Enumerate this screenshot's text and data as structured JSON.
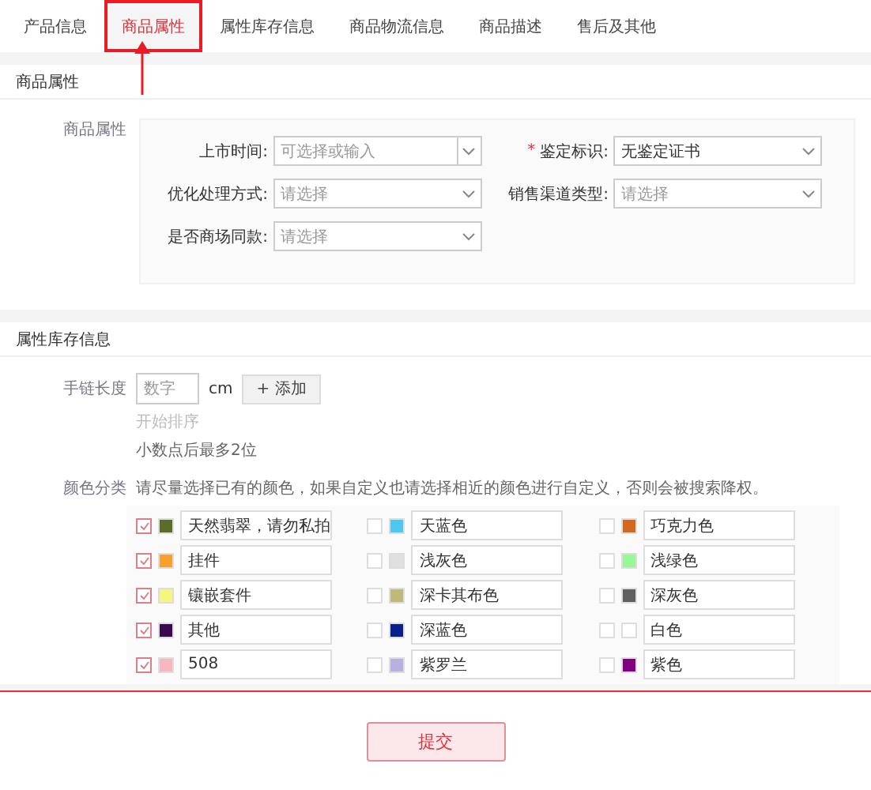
{
  "tabs": [
    {
      "label": "产品信息",
      "selected": false
    },
    {
      "label": "商品属性",
      "selected": true
    },
    {
      "label": "属性库存信息",
      "selected": false
    },
    {
      "label": "商品物流信息",
      "selected": false
    },
    {
      "label": "商品描述",
      "selected": false
    },
    {
      "label": "售后及其他",
      "selected": false
    }
  ],
  "attributes": {
    "title": "商品属性",
    "group_label": "商品属性",
    "fields": [
      {
        "label": "上市时间:",
        "kind": "combo",
        "placeholder": "可选择或输入"
      },
      {
        "label": "鉴定标识:",
        "kind": "select",
        "value": "无鉴定证书",
        "required_mark": "*"
      },
      {
        "label": "优化处理方式:",
        "kind": "select",
        "placeholder": "请选择"
      },
      {
        "label": "销售渠道类型:",
        "kind": "select",
        "placeholder": "请选择"
      },
      {
        "label": "是否商场同款:",
        "kind": "select",
        "placeholder": "请选择"
      }
    ]
  },
  "inventory": {
    "title": "属性库存信息",
    "length": {
      "label": "手链长度",
      "placeholder": "数字",
      "unit": "cm",
      "add_button": "+ 添加",
      "hint": "开始排序",
      "note": "小数点后最多2位"
    },
    "colors": {
      "label": "颜色分类",
      "note": "请尽量选择已有的颜色，如果自定义也请选择相近的颜色进行自定义，否则会被搜索降权。",
      "items": [
        {
          "name": "天然翡翠，请勿私拍",
          "checked": true,
          "color": "#5a6e2a"
        },
        {
          "name": "天蓝色",
          "checked": false,
          "color": "#4fc8f0"
        },
        {
          "name": "巧克力色",
          "checked": false,
          "color": "#d2691e"
        },
        {
          "name": "挂件",
          "checked": true,
          "color": "#f5a030"
        },
        {
          "name": "浅灰色",
          "checked": false,
          "color": "#e0e0e0"
        },
        {
          "name": "浅绿色",
          "checked": false,
          "color": "#98f898"
        },
        {
          "name": "镶嵌套件",
          "checked": true,
          "color": "#f5f580"
        },
        {
          "name": "深卡其布色",
          "checked": false,
          "color": "#c0b878"
        },
        {
          "name": "深灰色",
          "checked": false,
          "color": "#606060"
        },
        {
          "name": "其他",
          "checked": true,
          "color": "#3a0a50"
        },
        {
          "name": "深蓝色",
          "checked": false,
          "color": "#0a1e8c"
        },
        {
          "name": "白色",
          "checked": false,
          "color": "#ffffff"
        },
        {
          "name": "508",
          "checked": true,
          "color": "#f5b8c0"
        },
        {
          "name": "紫罗兰",
          "checked": false,
          "color": "#b8b0e0"
        },
        {
          "name": "紫色",
          "checked": false,
          "color": "#800080"
        }
      ]
    }
  },
  "submit": "提交"
}
